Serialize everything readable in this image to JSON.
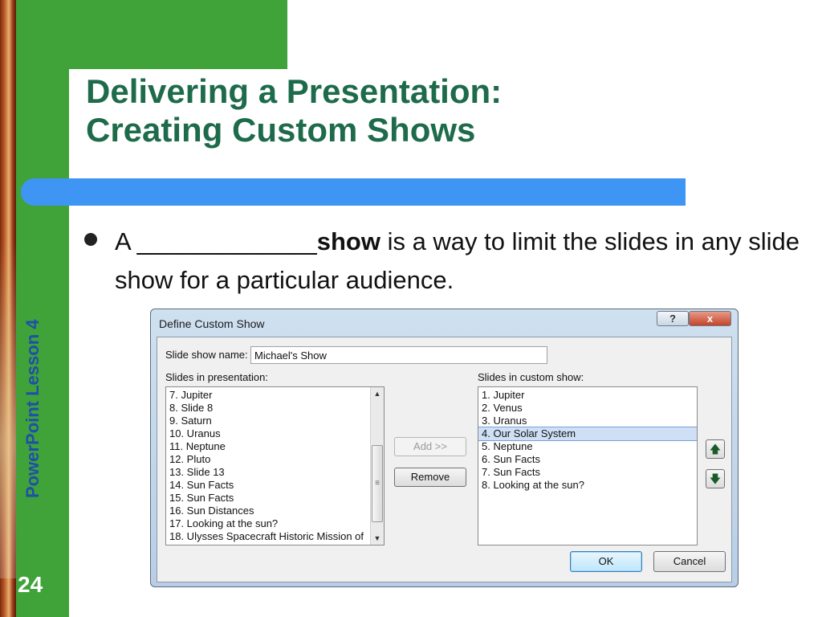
{
  "slide": {
    "title_line1": "Delivering a Presentation:",
    "title_line2": "Creating Custom Shows",
    "sidebar_label": "PowerPoint Lesson 4",
    "slide_number": "24",
    "bullet": {
      "prefix": "A _____________",
      "bold_word": "show",
      "suffix": " is a way to limit the slides in any slide show for a particular audience."
    }
  },
  "dialog": {
    "title": "Define Custom Show",
    "help_label": "?",
    "close_label": "x",
    "name_label": "Slide show name:",
    "name_value": "Michael's Show",
    "left_list_label": "Slides in presentation:",
    "right_list_label": "Slides in custom show:",
    "left_items": [
      "7. Jupiter",
      "8. Slide 8",
      "9. Saturn",
      "10. Uranus",
      "11. Neptune",
      "12. Pluto",
      "13. Slide 13",
      "14. Sun Facts",
      "15. Sun Facts",
      "16. Sun Distances",
      "17. Looking at the sun?",
      "18. Ulysses Spacecraft Historic Mission of"
    ],
    "right_items": [
      "1. Jupiter",
      "2. Venus",
      "3. Uranus",
      "4. Our Solar System",
      "5. Neptune",
      "6. Sun Facts",
      "7. Sun Facts",
      "8. Looking at the sun?"
    ],
    "selected_right_index": 3,
    "add_label": "Add >>",
    "remove_label": "Remove",
    "ok_label": "OK",
    "cancel_label": "Cancel",
    "move_up_icon": "arrow-up-icon",
    "move_down_icon": "arrow-down-icon"
  },
  "colors": {
    "sidebar_green": "#3fa33a",
    "title_green": "#1e6b4b",
    "accent_blue": "#3f95f3",
    "label_blue": "#1f4fa8"
  }
}
